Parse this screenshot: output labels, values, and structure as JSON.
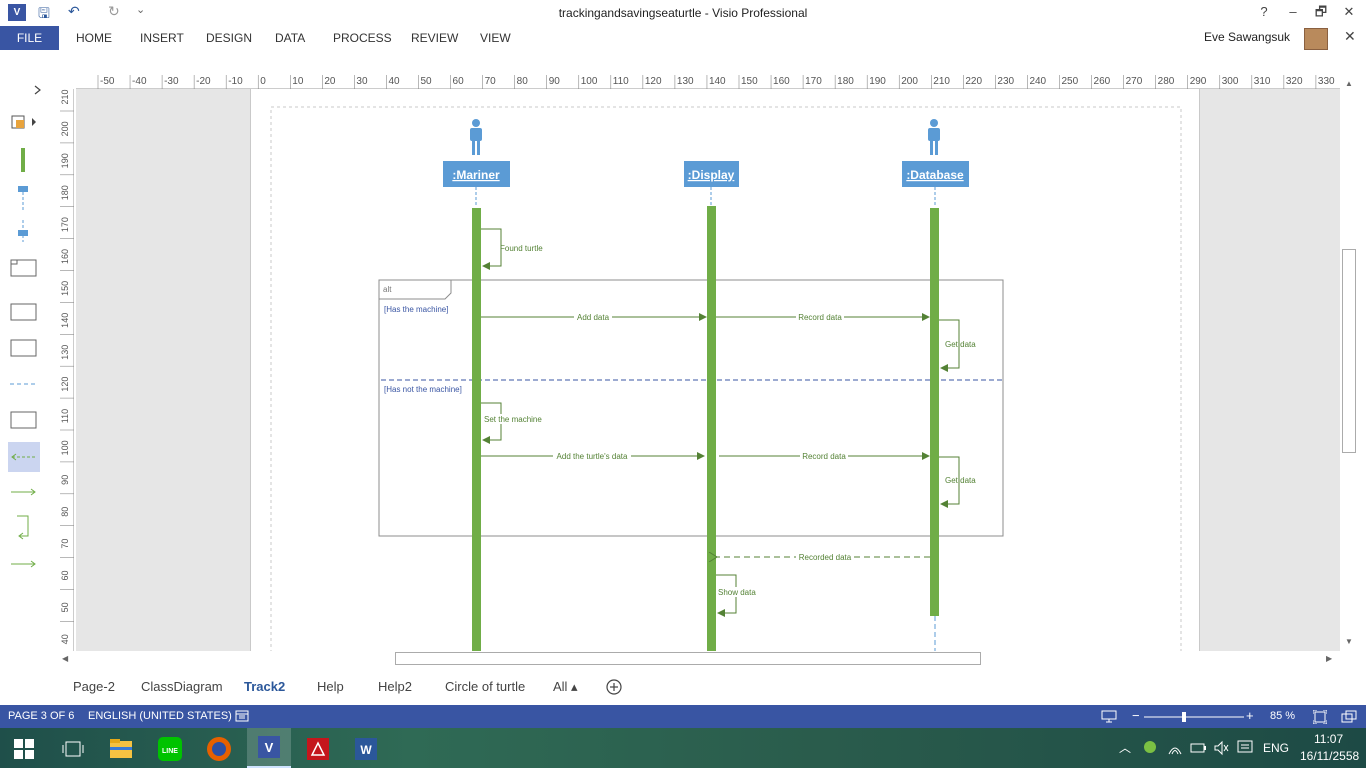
{
  "window": {
    "app_icon_label": "V",
    "title": "trackingandsavingseaturtle - Visio Professional",
    "help": "?",
    "minimize": "–",
    "restore": "🗗",
    "close": "✕",
    "quick_access": {
      "save": "🖫",
      "undo": "↶",
      "redo": "↻",
      "customize": "⌄"
    }
  },
  "ribbon": {
    "file": "FILE",
    "tabs": [
      "HOME",
      "INSERT",
      "DESIGN",
      "DATA",
      "PROCESS",
      "REVIEW",
      "VIEW"
    ],
    "user_name": "Eve Sawangsuk",
    "close_ribbon": "✕"
  },
  "ruler": {
    "horizontal": [
      "-50",
      "-40",
      "-30",
      "-20",
      "-10",
      "0",
      "10",
      "20",
      "30",
      "40",
      "50",
      "60",
      "70",
      "80",
      "90",
      "100",
      "110",
      "120",
      "130",
      "140",
      "150",
      "160",
      "170",
      "180",
      "190",
      "200",
      "210",
      "220",
      "230",
      "240",
      "250",
      "260",
      "270",
      "280",
      "290",
      "300",
      "310",
      "320",
      "330"
    ],
    "vertical": [
      "210",
      "200",
      "190",
      "180",
      "170",
      "160",
      "150",
      "140",
      "130",
      "120",
      "110",
      "100",
      "90",
      "80",
      "70",
      "60",
      "50",
      "40"
    ]
  },
  "diagram": {
    "lifelines": [
      ":Mariner",
      ":Display",
      ":Database"
    ],
    "alt_label": "alt",
    "guards": [
      "[Has the machine]",
      "[Has not the machine]"
    ],
    "messages": {
      "found_turtle": "Found turtle",
      "add_data": "Add data",
      "record_data_1": "Record data",
      "get_data_1": "Get data",
      "set_machine": "Set the machine",
      "add_turtle_data": "Add the turtle's data",
      "record_data_2": "Record data",
      "get_data_2": "Get data",
      "recorded_data": "Recorded data",
      "show_data": "Show data"
    }
  },
  "page_tabs": {
    "tabs": [
      "Page-2",
      "ClassDiagram",
      "Track2",
      "Help",
      "Help2",
      "Circle of turtle",
      "All ▴"
    ],
    "active": "Track2"
  },
  "status_bar": {
    "page": "PAGE 3 OF 6",
    "language": "ENGLISH (UNITED STATES)",
    "zoom": "85 %"
  },
  "taskbar": {
    "language": "ENG",
    "time": "11:07",
    "date": "16/11/2558"
  },
  "colors": {
    "accent": "#3955a3",
    "lifeline_head": "#5b9bd5",
    "activation": "#70ad47",
    "message": "#548235"
  }
}
